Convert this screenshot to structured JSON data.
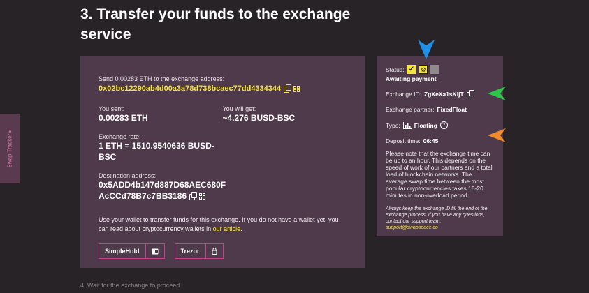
{
  "heading": "3. Transfer your funds to the exchange service",
  "main": {
    "send_label": "Send 0.00283 ETH to the exchange address:",
    "exchange_address": "0x02bc12290ab4d00a3a78d738bcaec77dd4334344",
    "you_sent_label": "You sent:",
    "you_sent_value": "0.00283 ETH",
    "you_get_label": "You will get:",
    "you_get_value": "~4.276 BUSD-BSC",
    "rate_label": "Exchange rate:",
    "rate_value_1": "1 ETH = 1510.9540636 BUSD-",
    "rate_value_2": "BSC",
    "destination_label": "Destination address:",
    "destination_line1": "0x5ADD4b147d887D68AEC680F",
    "destination_line2": "AcCCd78B7c7BB3186",
    "note_text": "Use your wallet to transfer funds for this exchange. If you do not have a wallet yet, you can read about cryptocurrency wallets in ",
    "note_link": "our article",
    "note_end": ".",
    "wallets": [
      "SimpleHold",
      "Trezor"
    ]
  },
  "status": {
    "label": "Status:",
    "state": "Awaiting payment",
    "exchange_id_label": "Exchange ID:",
    "exchange_id": "ZgXeXa1sKljT",
    "partner_label": "Exchange partner:",
    "partner": "FixedFloat",
    "type_label": "Type:",
    "type": "Floating",
    "deposit_label": "Deposit time:",
    "deposit_time": "06:45",
    "info": "Please note that the exchange time can be up to an hour. This depends on the speed of work of our partners and a total load of blockchain networks. The average swap time between the most popular cryptocurrencies takes 15-20 minutes in non-overload period.",
    "italic_note": "Always keep the exchange ID till the end of the exchange process. If you have any questions, contact our support team:",
    "support_email": "support@swapspace.co"
  },
  "tracker_label": "Swap Tracker ▸",
  "next_step": "4. Wait for the exchange to proceed",
  "colors": {
    "accent": "#f5e43b",
    "card": "#4e3a4a",
    "bg": "#282327",
    "pink": "#c2448f",
    "arrow_blue": "#1e90e8",
    "arrow_green": "#2fc74a",
    "arrow_orange": "#f08a2a"
  }
}
